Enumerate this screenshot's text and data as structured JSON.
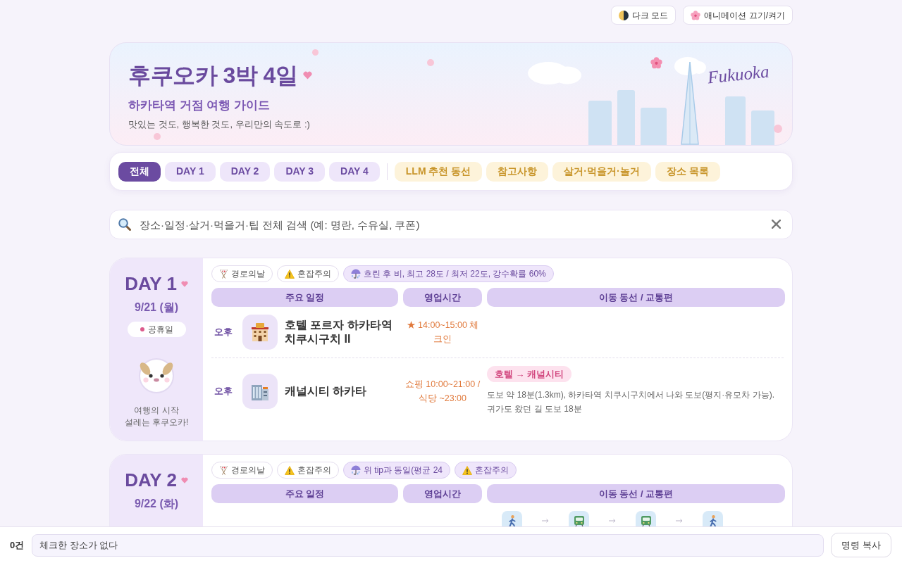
{
  "top_buttons": [
    {
      "kind": "theme",
      "label": "다크 모드"
    },
    {
      "kind": "animation",
      "label": "애니메이션 끄기/켜기"
    }
  ],
  "hero": {
    "title": "후쿠오카 3박 4일",
    "subtitle": "하카타역 거점 여행 가이드",
    "tagline": "맛있는 것도, 행복한 것도, 우리만의 속도로 :)",
    "city_label": "Fukuoka"
  },
  "nav_tabs": [
    {
      "label": "전체",
      "kind": "day",
      "selected": true
    },
    {
      "label": "DAY 1",
      "kind": "day",
      "selected": false
    },
    {
      "label": "DAY 2",
      "kind": "day",
      "selected": false
    },
    {
      "label": "DAY 3",
      "kind": "day",
      "selected": false
    },
    {
      "label": "DAY 4",
      "kind": "day",
      "selected": false
    },
    {
      "label": "LLM 추천 동선",
      "kind": "section",
      "selected": false
    },
    {
      "label": "참고사항",
      "kind": "section",
      "selected": false
    },
    {
      "label": "살거·먹을거·놀거",
      "kind": "section",
      "selected": false
    },
    {
      "label": "장소 목록",
      "kind": "section",
      "selected": false
    }
  ],
  "search": {
    "placeholder": "장소·일정·살거·먹을거·팁 전체 검색 (예: 명란, 수유실, 쿠폰)"
  },
  "days": [
    {
      "label": "DAY 1",
      "date": "9/21 (월)",
      "badge": "공휴일",
      "caption": "여행의 시작\n설레는 후쿠오카!",
      "tags": [
        {
          "kind": "holiday",
          "label": "경로의날",
          "filled": false
        },
        {
          "kind": "crowd",
          "label": "혼잡주의",
          "filled": false
        },
        {
          "kind": "weather",
          "label": "흐린 후 비, 최고 28도 / 최저 22도, 강수확률 60%",
          "filled": true
        }
      ],
      "columns": [
        "주요 일정",
        "영업시간",
        "이동 동선 / 교통편"
      ],
      "items": [
        {
          "time": "오후",
          "kind": "hotel",
          "name": "호텔 포르자 하카타역 치쿠시구치 II",
          "hours": "★ 14:00~15:00 체크인"
        },
        {
          "time": "오후",
          "kind": "mall",
          "name": "캐널시티 하카타",
          "hours": "쇼핑 10:00~21:00 / 식당 ~23:00",
          "transit": {
            "route": "호텔 → 캐널시티",
            "note": "도보 약 18분(1.3km), 하카타역 치쿠시구치에서 나와 도보(평지·유모차 가능). 귀가도 왔던 길 도보 18분"
          }
        }
      ]
    },
    {
      "label": "DAY 2",
      "date": "9/22 (화)",
      "tags": [
        {
          "kind": "holiday",
          "label": "경로의날",
          "filled": false
        },
        {
          "kind": "crowd",
          "label": "혼잡주의",
          "filled": false
        },
        {
          "kind": "weather",
          "label": "위 tip과 동일(평균 24",
          "filled": true
        },
        {
          "kind": "crowd",
          "label": "혼잡주의",
          "filled": true
        }
      ],
      "columns": [
        "주요 일정",
        "영업시간",
        "이동 동선 / 교통편"
      ],
      "items": [
        {
          "transit": {
            "steps": [
              {
                "kind": "walk"
              },
              {
                "kind": "train"
              },
              {
                "kind": "train"
              },
              {
                "kind": "walk"
              }
            ]
          }
        }
      ]
    }
  ],
  "bottom_bar": {
    "count": "0건",
    "checked_places": "체크한 장소가 없다",
    "copy_button": "명령 복사"
  }
}
